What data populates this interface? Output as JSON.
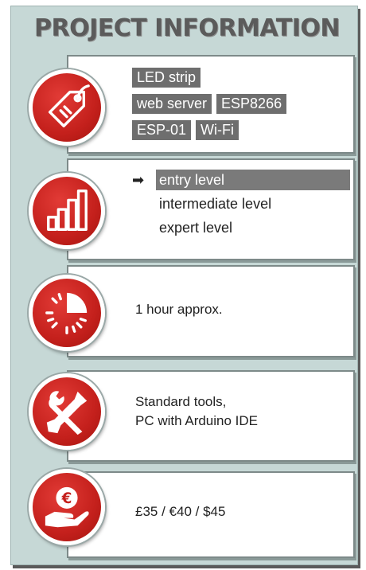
{
  "header": {
    "title": "PROJECT INFORMATION"
  },
  "tags": [
    "LED strip",
    "web server",
    "ESP8266",
    "ESP-01",
    "Wi-Fi"
  ],
  "difficulty": {
    "levels": [
      "entry level",
      "intermediate level",
      "expert level"
    ],
    "selected_index": 0,
    "pointer_glyph": "➡"
  },
  "time": {
    "text": "1 hour approx."
  },
  "tools": {
    "line1": "Standard tools,",
    "line2": "PC with Arduino IDE"
  },
  "cost": {
    "text": "£35 / €40 / $45"
  },
  "icons": {
    "tags": "price-tag-icon",
    "difficulty": "signal-bars-icon",
    "time": "clock-icon",
    "tools": "wrench-screwdriver-icon",
    "cost": "hand-euro-coin-icon"
  },
  "colors": {
    "accent_red": "#c4201c",
    "background": "#c6d8d6",
    "tag_gray": "#6e6e6e"
  }
}
